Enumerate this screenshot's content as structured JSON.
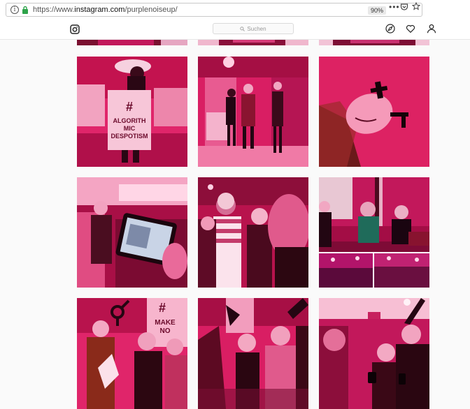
{
  "browser": {
    "url_prefix": "https://www.",
    "url_host": "instagram.com",
    "url_path": "/purplenoiseup/",
    "zoom": "90%",
    "menu_glyph": "•••",
    "icons": [
      "info-icon",
      "lock-icon",
      "page-actions-icon",
      "pocket-icon",
      "star-icon"
    ]
  },
  "header": {
    "search_placeholder": "Suchen",
    "icons": [
      "instagram-logo-icon",
      "search-icon",
      "compass-icon",
      "heart-icon",
      "user-icon"
    ]
  },
  "posts": {
    "sign_hash": "#",
    "sign_line1": "ALGORITH",
    "sign_line2": "MIC",
    "sign_line3": "DESPOTISM",
    "sign_make_hash": "#",
    "sign_make": "MAKE",
    "sign_make2": "NO"
  },
  "colors": {
    "accent_magenta": "#e0256a",
    "deep_magenta": "#a30d45",
    "bright_pink": "#ff4f8f"
  }
}
